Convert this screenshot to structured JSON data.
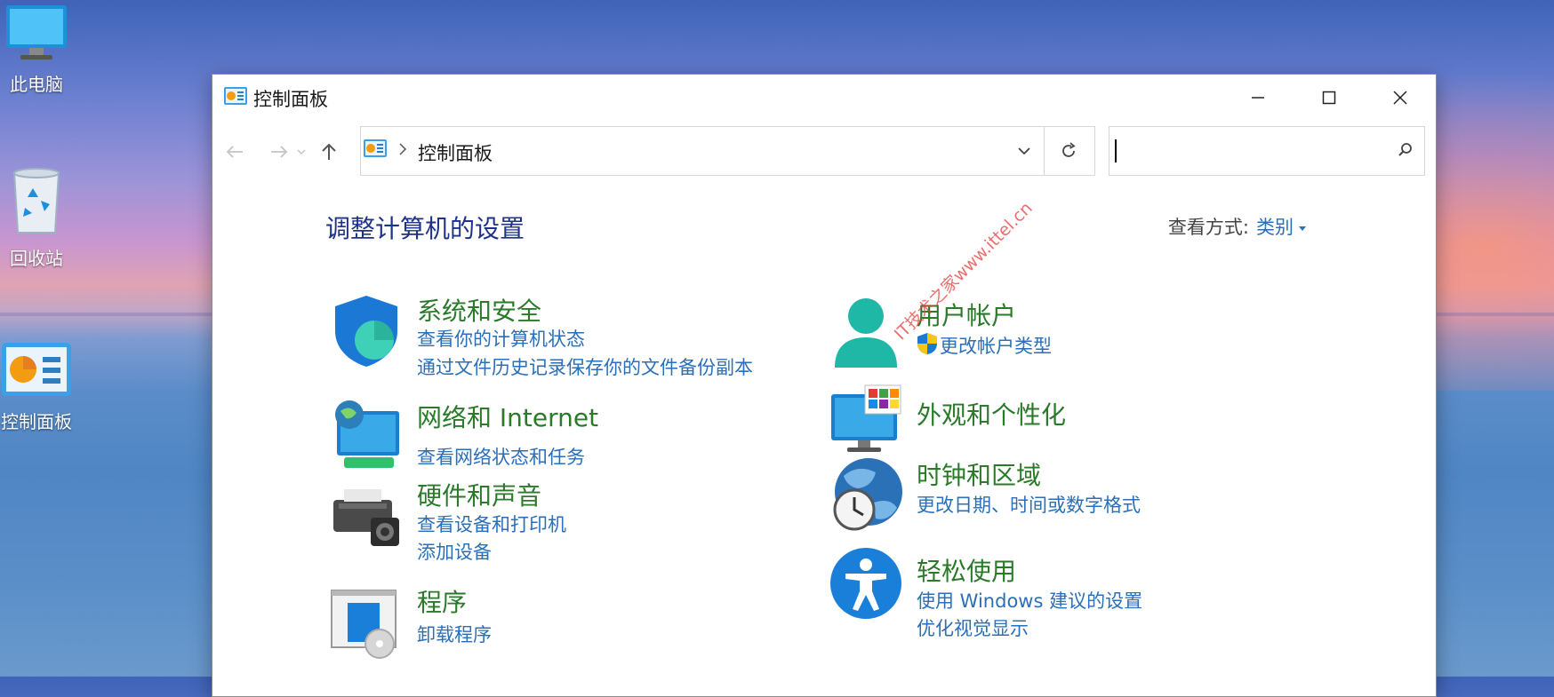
{
  "desktop": {
    "icons": [
      {
        "label": "此电脑",
        "icon": "monitor-icon"
      },
      {
        "label": "回收站",
        "icon": "recycle-bin-icon"
      },
      {
        "label": "控制面板",
        "icon": "control-panel-icon"
      }
    ]
  },
  "window": {
    "title": "控制面板",
    "address": {
      "crumb": "控制面板"
    },
    "search": {
      "placeholder": ""
    },
    "heading": "调整计算机的设置",
    "view_by": {
      "label": "查看方式:",
      "value": "类别"
    },
    "categories": [
      {
        "title": "系统和安全",
        "icon": "shield-icon",
        "links": [
          "查看你的计算机状态",
          "通过文件历史记录保存你的文件备份副本"
        ]
      },
      {
        "title": "网络和 Internet",
        "icon": "network-globe-icon",
        "links": [
          "查看网络状态和任务"
        ]
      },
      {
        "title": "硬件和声音",
        "icon": "printer-icon",
        "links": [
          "查看设备和打印机",
          "添加设备"
        ]
      },
      {
        "title": "程序",
        "icon": "programs-icon",
        "links": [
          "卸载程序"
        ]
      },
      {
        "title": "用户帐户",
        "icon": "user-icon",
        "links": [
          "更改帐户类型"
        ]
      },
      {
        "title": "外观和个性化",
        "icon": "monitor-color-icon",
        "links": []
      },
      {
        "title": "时钟和区域",
        "icon": "clock-globe-icon",
        "links": [
          "更改日期、时间或数字格式"
        ]
      },
      {
        "title": "轻松使用",
        "icon": "accessibility-icon",
        "links": [
          "使用 Windows 建议的设置",
          "优化视觉显示"
        ]
      }
    ]
  },
  "watermark": "IT技术之家www.ittel.cn",
  "colors": {
    "category_title": "#2a7a2a",
    "link": "#2a6fb8",
    "heading": "#1e3287"
  }
}
